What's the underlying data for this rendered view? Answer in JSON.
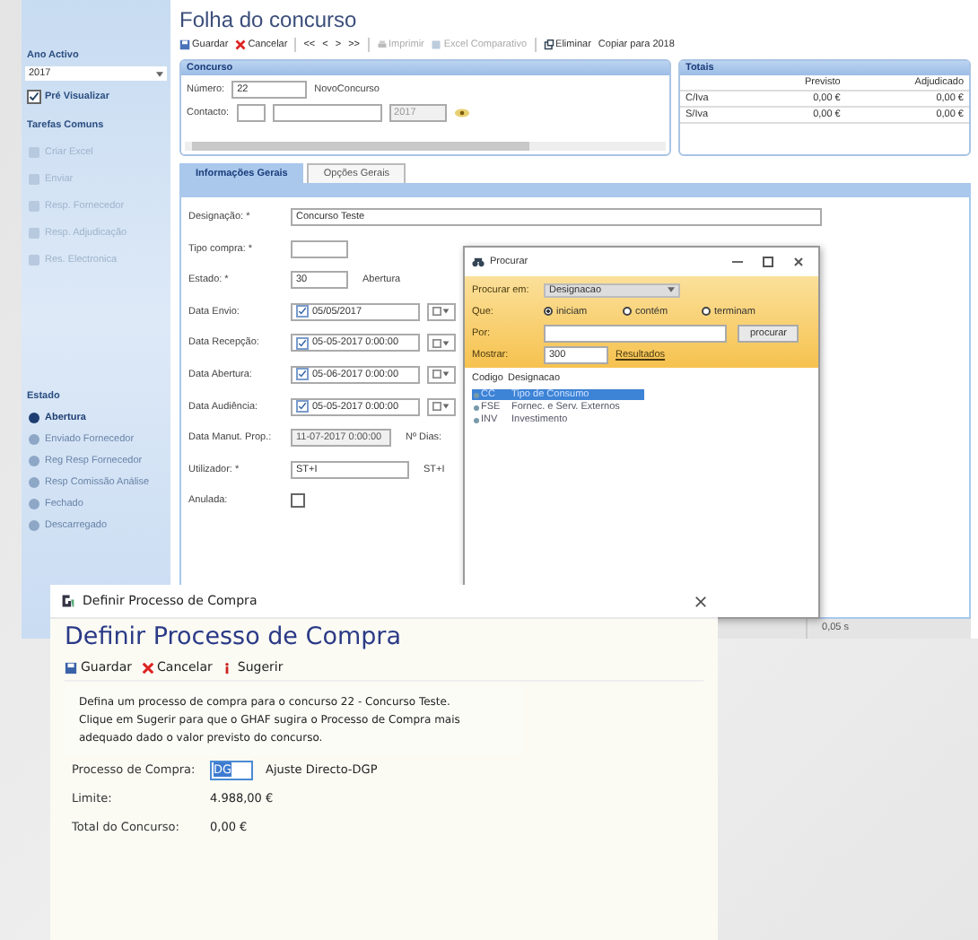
{
  "sidebar": {
    "year_label": "Ano Activo",
    "year_value": "2017",
    "preview": {
      "label": "Pré Visualizar",
      "checked": true
    },
    "tasks_title": "Tarefas Comuns",
    "tasks": [
      {
        "label": "Criar Excel",
        "disabled": true
      },
      {
        "label": "Enviar",
        "disabled": true
      },
      {
        "label": "Resp. Fornecedor",
        "disabled": true
      },
      {
        "label": "Resp. Adjudicação",
        "disabled": true
      },
      {
        "label": "Res. Electronica",
        "disabled": true
      }
    ],
    "state_title": "Estado",
    "states": [
      {
        "label": "Abertura",
        "selected": true
      },
      {
        "label": "Enviado Fornecedor",
        "selected": false
      },
      {
        "label": "Reg Resp Fornecedor",
        "selected": false
      },
      {
        "label": "Resp Comissão Análise",
        "selected": false
      },
      {
        "label": "Fechado",
        "selected": false
      },
      {
        "label": "Descarregado",
        "selected": false
      }
    ]
  },
  "main": {
    "title": "Folha do concurso",
    "toolbar": [
      {
        "kind": "save",
        "label": "Guardar",
        "disabled": false
      },
      {
        "kind": "cancel",
        "label": "Cancelar",
        "disabled": false
      },
      {
        "kind": "nav",
        "label": "<<",
        "disabled": false
      },
      {
        "kind": "nav",
        "label": "<",
        "disabled": false
      },
      {
        "kind": "nav",
        "label": ">",
        "disabled": false
      },
      {
        "kind": "nav",
        "label": ">>",
        "disabled": false
      },
      {
        "kind": "print",
        "label": "Imprimir",
        "disabled": true
      },
      {
        "kind": "excel",
        "label": "Excel Comparativo",
        "disabled": true
      },
      {
        "kind": "delete",
        "label": "Eliminar",
        "disabled": false
      },
      {
        "kind": "plain",
        "label": "Copiar para 2018",
        "disabled": false
      }
    ],
    "concurso": {
      "title": "Concurso",
      "number_label": "Número:",
      "number": "22",
      "number_note": "NovoConcurso",
      "contact_label": "Contacto:",
      "year": "2017"
    },
    "totais": {
      "title": "Totais",
      "columns": [
        "Previsto",
        "Adjudicado"
      ],
      "rows": [
        {
          "label": "C/Iva",
          "values": [
            "0,00 €",
            "0,00 €"
          ]
        },
        {
          "label": "S/Iva",
          "values": [
            "0,00 €",
            "0,00 €"
          ]
        }
      ]
    },
    "tabs": [
      {
        "label": "Informações Gerais",
        "selected": true
      },
      {
        "label": "Opções Gerais",
        "selected": false
      }
    ],
    "form": [
      {
        "kind": "long_text",
        "label": "Designação: *",
        "value": "Concurso Teste"
      },
      {
        "kind": "short_text",
        "label": "Tipo compra: *"
      },
      {
        "kind": "short_text",
        "label": "Estado: *",
        "value": "30",
        "note": "Abertura"
      },
      {
        "kind": "date",
        "label": "Data Envio:",
        "value": "05/05/2017",
        "checked": true
      },
      {
        "kind": "date",
        "label": "Data Recepção:",
        "value": "05-05-2017 0:00:00",
        "checked": true
      },
      {
        "kind": "date",
        "label": "Data Abertura:",
        "value": "05-06-2017 0:00:00",
        "checked": true
      },
      {
        "kind": "date",
        "label": "Data Audiência:",
        "value": "05-05-2017 0:00:00",
        "checked": true
      },
      {
        "kind": "readonly",
        "label": "Data Manut. Prop.:",
        "value": "11-07-2017 0:00:00",
        "note": "Nº Dias:"
      },
      {
        "kind": "medium_text",
        "label": "Utilizador: *",
        "value": "ST+I",
        "note": "ST+I"
      },
      {
        "kind": "checkbox",
        "label": "Anulada:",
        "checked": false
      }
    ],
    "status": "0,05 s"
  },
  "search": {
    "title": "Procurar",
    "search_in_label": "Procurar em:",
    "search_in": "Designacao",
    "match_label": "Que:",
    "match_options": [
      {
        "label": "iniciam",
        "selected": true
      },
      {
        "label": "contém",
        "selected": false
      },
      {
        "label": "terminam",
        "selected": false
      }
    ],
    "for_label": "Por:",
    "search_button": "procurar",
    "show_label": "Mostrar:",
    "show_value": "300",
    "show_note": "Resultados",
    "columns": [
      "Codigo",
      "Designacao"
    ],
    "rows": [
      {
        "code": "CC",
        "name": "Tipo de Consumo",
        "selected": true
      },
      {
        "code": "FSE",
        "name": "Fornec. e Serv. Externos",
        "selected": false
      },
      {
        "code": "INV",
        "name": "Investimento",
        "selected": false
      }
    ]
  },
  "dialog": {
    "window_title": "Definir Processo de Compra",
    "heading": "Definir Processo de Compra",
    "toolbar": [
      {
        "kind": "save",
        "label": "Guardar"
      },
      {
        "kind": "cancel",
        "label": "Cancelar"
      },
      {
        "kind": "info",
        "label": "Sugerir"
      }
    ],
    "description": "Defina um processo de compra para o concurso 22 - Concurso Teste.\nClique em Sugerir para que o GHAF sugira o Processo de Compra mais adequado dado o valor previsto do concurso.",
    "fields": [
      {
        "kind": "code",
        "label": "Processo de Compra:",
        "value": "DG",
        "note": "Ajuste Directo-DGP"
      },
      {
        "kind": "value",
        "label": "Limite:",
        "value": "4.988,00 €"
      },
      {
        "kind": "value",
        "label": "Total do Concurso:",
        "value": "0,00 €"
      }
    ]
  }
}
